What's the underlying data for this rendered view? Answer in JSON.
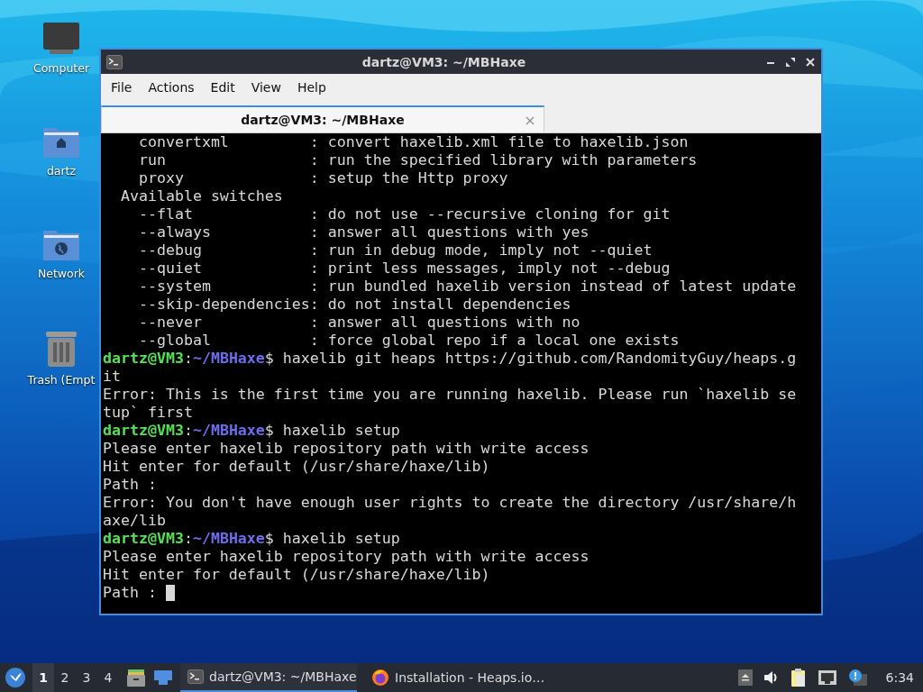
{
  "desktop_icons": [
    {
      "label": "Computer",
      "kind": "computer"
    },
    {
      "label": "dartz",
      "kind": "home"
    },
    {
      "label": "Network",
      "kind": "network"
    },
    {
      "label": "Trash (Empt",
      "kind": "trash"
    }
  ],
  "window": {
    "title": "dartz@VM3: ~/MBHaxe",
    "menu": [
      "File",
      "Actions",
      "Edit",
      "View",
      "Help"
    ],
    "tabs": [
      {
        "label": "dartz@VM3: ~/MBHaxe",
        "selected": true
      }
    ],
    "terminal_lines": [
      {
        "kind": "text",
        "text": "    convertxml         : convert haxelib.xml file to haxelib.json"
      },
      {
        "kind": "text",
        "text": "    run                : run the specified library with parameters"
      },
      {
        "kind": "text",
        "text": "    proxy              : setup the Http proxy"
      },
      {
        "kind": "text",
        "text": "  Available switches"
      },
      {
        "kind": "text",
        "text": "    --flat             : do not use --recursive cloning for git"
      },
      {
        "kind": "text",
        "text": "    --always           : answer all questions with yes"
      },
      {
        "kind": "text",
        "text": "    --debug            : run in debug mode, imply not --quiet"
      },
      {
        "kind": "text",
        "text": "    --quiet            : print less messages, imply not --debug"
      },
      {
        "kind": "text",
        "text": "    --system           : run bundled haxelib version instead of latest update"
      },
      {
        "kind": "text",
        "text": "    --skip-dependencies: do not install dependencies"
      },
      {
        "kind": "text",
        "text": "    --never            : answer all questions with no"
      },
      {
        "kind": "text",
        "text": "    --global           : force global repo if a local one exists"
      },
      {
        "kind": "prompt",
        "user": "dartz@VM3",
        "sep": ":",
        "path": "~/MBHaxe",
        "text": "$ haxelib git heaps https://github.com/RandomityGuy/heaps.g"
      },
      {
        "kind": "text",
        "text": "it"
      },
      {
        "kind": "text",
        "text": "Error: This is the first time you are running haxelib. Please run `haxelib se"
      },
      {
        "kind": "text",
        "text": "tup` first"
      },
      {
        "kind": "prompt",
        "user": "dartz@VM3",
        "sep": ":",
        "path": "~/MBHaxe",
        "text": "$ haxelib setup"
      },
      {
        "kind": "text",
        "text": "Please enter haxelib repository path with write access"
      },
      {
        "kind": "text",
        "text": "Hit enter for default (/usr/share/haxe/lib)"
      },
      {
        "kind": "text",
        "text": "Path :"
      },
      {
        "kind": "text",
        "text": "Error: You don't have enough user rights to create the directory /usr/share/h"
      },
      {
        "kind": "text",
        "text": "axe/lib"
      },
      {
        "kind": "prompt",
        "user": "dartz@VM3",
        "sep": ":",
        "path": "~/MBHaxe",
        "text": "$ haxelib setup"
      },
      {
        "kind": "text",
        "text": "Please enter haxelib repository path with write access"
      },
      {
        "kind": "text",
        "text": "Hit enter for default (/usr/share/haxe/lib)"
      },
      {
        "kind": "text",
        "text": "Path :",
        "cursor": true
      }
    ]
  },
  "taskbar": {
    "workspaces": [
      {
        "label": "1",
        "selected": true
      },
      {
        "label": "2",
        "selected": false
      },
      {
        "label": "3",
        "selected": false
      },
      {
        "label": "4",
        "selected": false
      }
    ],
    "tasks": [
      {
        "label": "dartz@VM3: ~/MBHaxe",
        "kind": "terminal",
        "selected": true
      },
      {
        "label": "Installation - Heaps.io…",
        "kind": "browser",
        "selected": false
      }
    ],
    "clock": "6:34"
  }
}
